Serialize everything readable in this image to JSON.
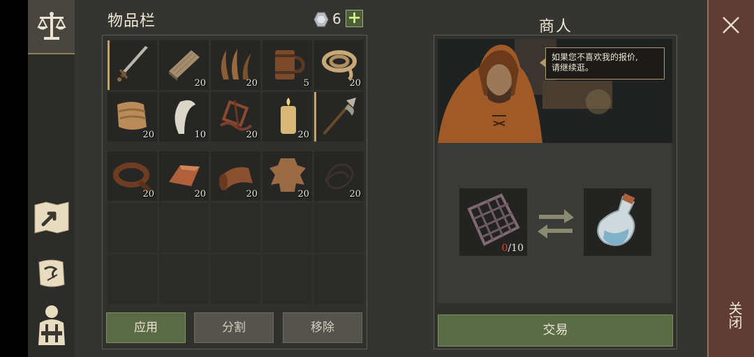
{
  "inventory": {
    "title": "物品栏",
    "gem_count": "6",
    "add_label": "+",
    "slots": [
      {
        "icon": "sword-icon",
        "qty": ""
      },
      {
        "icon": "wood-plank-icon",
        "qty": "20"
      },
      {
        "icon": "fiber-icon",
        "qty": "20"
      },
      {
        "icon": "tankard-icon",
        "qty": "5"
      },
      {
        "icon": "rope-icon",
        "qty": "20"
      },
      {
        "icon": "cloth-icon",
        "qty": "20"
      },
      {
        "icon": "tooth-icon",
        "qty": "10"
      },
      {
        "icon": "scrap-icon",
        "qty": "20"
      },
      {
        "icon": "candle-icon",
        "qty": "20"
      },
      {
        "icon": "halberd-icon",
        "qty": ""
      },
      {
        "icon": "leather-strap-icon",
        "qty": "20"
      },
      {
        "icon": "copper-ingot-icon",
        "qty": "20"
      },
      {
        "icon": "leather-roll-icon",
        "qty": "20"
      },
      {
        "icon": "hide-icon",
        "qty": "20"
      },
      {
        "icon": "cord-icon",
        "qty": "20"
      }
    ],
    "buttons": {
      "apply": "应用",
      "split": "分割",
      "remove": "移除"
    }
  },
  "merchant": {
    "title": "商人",
    "speech_line1": "如果您不喜欢我的报价,",
    "speech_line2": "请继续逛。",
    "trade": {
      "give_have": "0",
      "give_need": "/10",
      "give_icon": "iron-grate-icon",
      "receive_icon": "potion-bottle-icon"
    },
    "trade_button": "交易"
  },
  "close_label": "关闭",
  "sidebar": [
    "balance-scale-icon",
    "map-icon",
    "scroll-icon",
    "backpack-icon"
  ],
  "colors": {
    "accent_green": "#5b6b46",
    "close_panel": "#5e3d34",
    "count_red": "#d74a3c"
  }
}
